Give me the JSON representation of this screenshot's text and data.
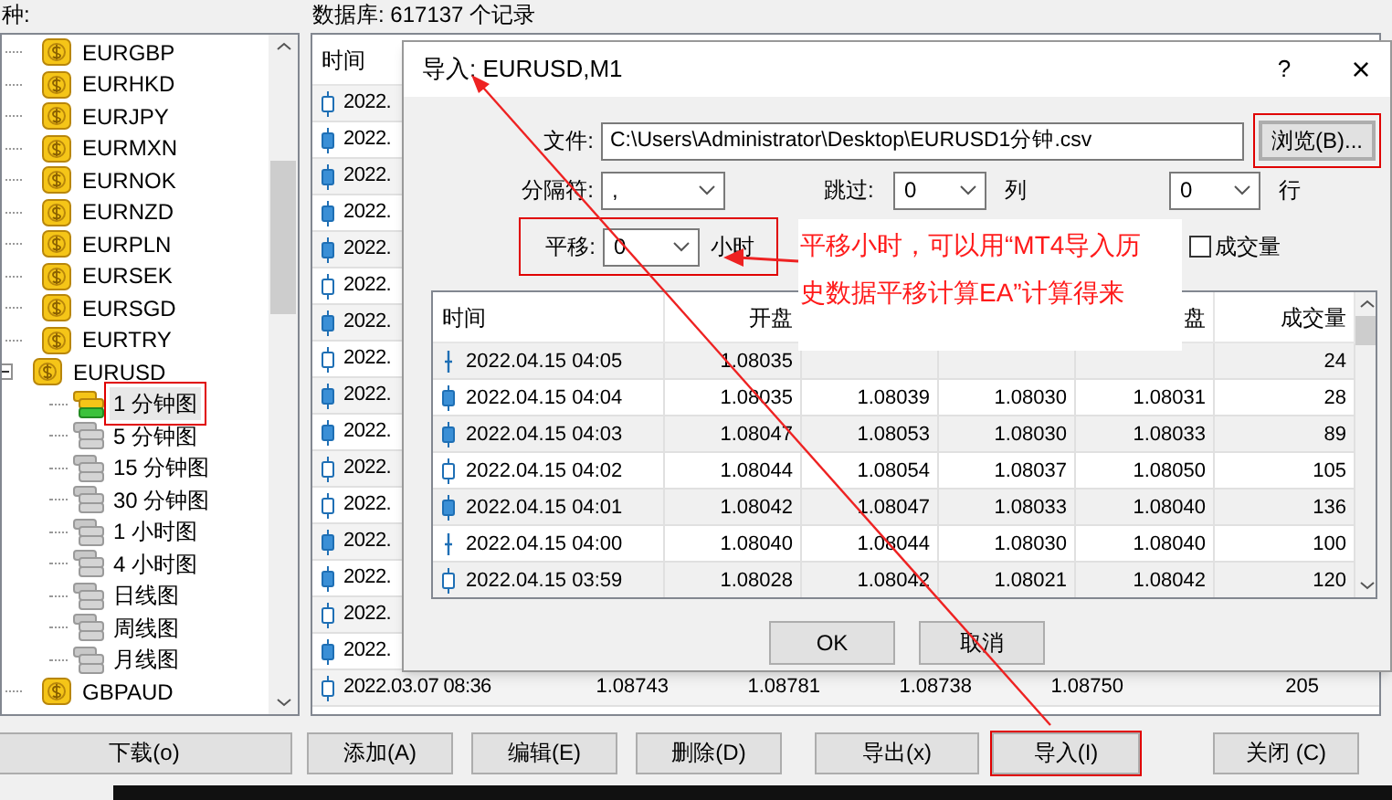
{
  "symbols_panel": {
    "title": "种:",
    "items": [
      {
        "label": "EURGBP"
      },
      {
        "label": "EURHKD"
      },
      {
        "label": "EURJPY"
      },
      {
        "label": "EURMXN"
      },
      {
        "label": "EURNOK"
      },
      {
        "label": "EURNZD"
      },
      {
        "label": "EURPLN"
      },
      {
        "label": "EURSEK"
      },
      {
        "label": "EURSGD"
      },
      {
        "label": "EURTRY"
      },
      {
        "label": "EURUSD",
        "expanded": true,
        "children": [
          {
            "label": "1 分钟图",
            "selected": true
          },
          {
            "label": "5 分钟图",
            "selected": false
          },
          {
            "label": "15 分钟图",
            "selected": false
          },
          {
            "label": "30 分钟图",
            "selected": false
          },
          {
            "label": "1 小时图",
            "selected": false
          },
          {
            "label": "4 小时图",
            "selected": false
          },
          {
            "label": "日线图",
            "selected": false
          },
          {
            "label": "周线图",
            "selected": false
          },
          {
            "label": "月线图",
            "selected": false
          }
        ]
      },
      {
        "label": "GBPAUD"
      }
    ]
  },
  "database_label": "数据库: 617137 个记录",
  "history_table": {
    "time_column": "时间",
    "rows": [
      {
        "kind": "bull",
        "time": "2022."
      },
      {
        "kind": "bear",
        "time": "2022."
      },
      {
        "kind": "bear",
        "time": "2022."
      },
      {
        "kind": "bear",
        "time": "2022."
      },
      {
        "kind": "bear",
        "time": "2022."
      },
      {
        "kind": "bull",
        "time": "2022."
      },
      {
        "kind": "bear",
        "time": "2022."
      },
      {
        "kind": "bull",
        "time": "2022."
      },
      {
        "kind": "bear",
        "time": "2022."
      },
      {
        "kind": "bear",
        "time": "2022."
      },
      {
        "kind": "bull",
        "time": "2022."
      },
      {
        "kind": "bull",
        "time": "2022."
      },
      {
        "kind": "bear",
        "time": "2022."
      },
      {
        "kind": "bear",
        "time": "2022."
      },
      {
        "kind": "bull",
        "time": "2022."
      },
      {
        "kind": "bear",
        "time": "2022."
      },
      {
        "kind": "bull",
        "time": "2022.03.07 08:36",
        "values": [
          "1.08743",
          "1.08781",
          "1.08738",
          "1.08750",
          "205"
        ]
      }
    ]
  },
  "buttons": [
    "下载(o)",
    "添加(A)",
    "编辑(E)",
    "删除(D)",
    "导出(x)",
    "导入(I)",
    "关闭 (C)"
  ],
  "dialog": {
    "title": "导入: EURUSD,M1",
    "help": "?",
    "close": "×",
    "file_label": "文件:",
    "file_value": "C:\\Users\\Administrator\\Desktop\\EURUSD1分钟.csv",
    "browse_button": "浏览(B)...",
    "separator_label": "分隔符:",
    "separator_value": ",",
    "skip_label": "跳过:",
    "skip_columns_value": "0",
    "columns_unit": "列",
    "skip_rows_value": "0",
    "rows_unit": "行",
    "shift_label": "平移:",
    "shift_value": "0",
    "shift_unit": "小时",
    "volume_checkbox": {
      "label": "成交量",
      "checked": false
    },
    "table": {
      "columns": {
        "time": "时间",
        "open": "开盘",
        "close": "盘",
        "volume": "成交量"
      },
      "rows": [
        {
          "kind": "doji",
          "time": "2022.04.15 04:05",
          "open": "1.08035",
          "volume": "24"
        },
        {
          "kind": "bear",
          "time": "2022.04.15 04:04",
          "open": "1.08035",
          "high": "1.08039",
          "low": "1.08030",
          "close": "1.08031",
          "volume": "28"
        },
        {
          "kind": "bear",
          "time": "2022.04.15 04:03",
          "open": "1.08047",
          "high": "1.08053",
          "low": "1.08030",
          "close": "1.08033",
          "volume": "89"
        },
        {
          "kind": "bull",
          "time": "2022.04.15 04:02",
          "open": "1.08044",
          "high": "1.08054",
          "low": "1.08037",
          "close": "1.08050",
          "volume": "105"
        },
        {
          "kind": "bear",
          "time": "2022.04.15 04:01",
          "open": "1.08042",
          "high": "1.08047",
          "low": "1.08033",
          "close": "1.08040",
          "volume": "136"
        },
        {
          "kind": "doji",
          "time": "2022.04.15 04:00",
          "open": "1.08040",
          "high": "1.08044",
          "low": "1.08030",
          "close": "1.08040",
          "volume": "100"
        },
        {
          "kind": "bull",
          "time": "2022.04.15 03:59",
          "open": "1.08028",
          "high": "1.08042",
          "low": "1.08021",
          "close": "1.08042",
          "volume": "120"
        }
      ]
    },
    "ok_button": "OK",
    "cancel_button": "取消"
  },
  "annotation": {
    "lines": [
      "平移小时，可以用“MT4导入历",
      "史数据平移计算EA”计算得来"
    ]
  }
}
